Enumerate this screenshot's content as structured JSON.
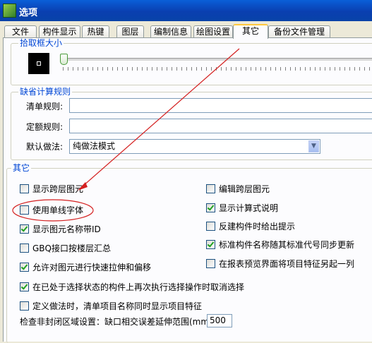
{
  "window": {
    "title": "选项",
    "app_icon": "app-icon"
  },
  "tabs": [
    "文件",
    "构件显示",
    "热键",
    "图层",
    "编制信息",
    "绘图设置",
    "其它",
    "备份文件管理"
  ],
  "active_tab": "其它",
  "pick_box": {
    "legend": "拾取框大小"
  },
  "default_rules": {
    "legend": "缺省计算规则",
    "list_rule_label": "清单规则:",
    "list_rule_value": "",
    "quota_rule_label": "定额规则:",
    "quota_rule_value": "",
    "default_method_label": "默认做法:",
    "default_method_value": "纯做法模式"
  },
  "other": {
    "legend": "其它",
    "options": [
      {
        "label": "显示跨层图元",
        "checked": false
      },
      {
        "label": "编辑跨层图元",
        "checked": false
      },
      {
        "label": "使用单线字体",
        "checked": false
      },
      {
        "label": "显示计算式说明",
        "checked": true
      },
      {
        "label": "显示图元名称带ID",
        "checked": true
      },
      {
        "label": "反建构件时给出提示",
        "checked": false
      },
      {
        "label": "GBQ接口按楼层汇总",
        "checked": false
      },
      {
        "label": "标准构件名称随其标准代号同步更新",
        "checked": true
      },
      {
        "label": "允许对图元进行快速拉伸和偏移",
        "checked": true
      },
      {
        "label": "在报表预览界面将项目特征另起一列",
        "checked": false
      },
      {
        "label": "在已处于选择状态的构件上再次执行选择操作时取消选择",
        "checked": true
      },
      {
        "label": "定义做法时，清单项目名称同时显示项目特征",
        "checked": false
      }
    ],
    "gap_check_label": "检查非封闭区域设置：缺口相交误差延伸范围(mm)",
    "gap_check_value": "500"
  },
  "annotation": {
    "arrow_color": "#d42020",
    "circle_color": "#d42020"
  }
}
